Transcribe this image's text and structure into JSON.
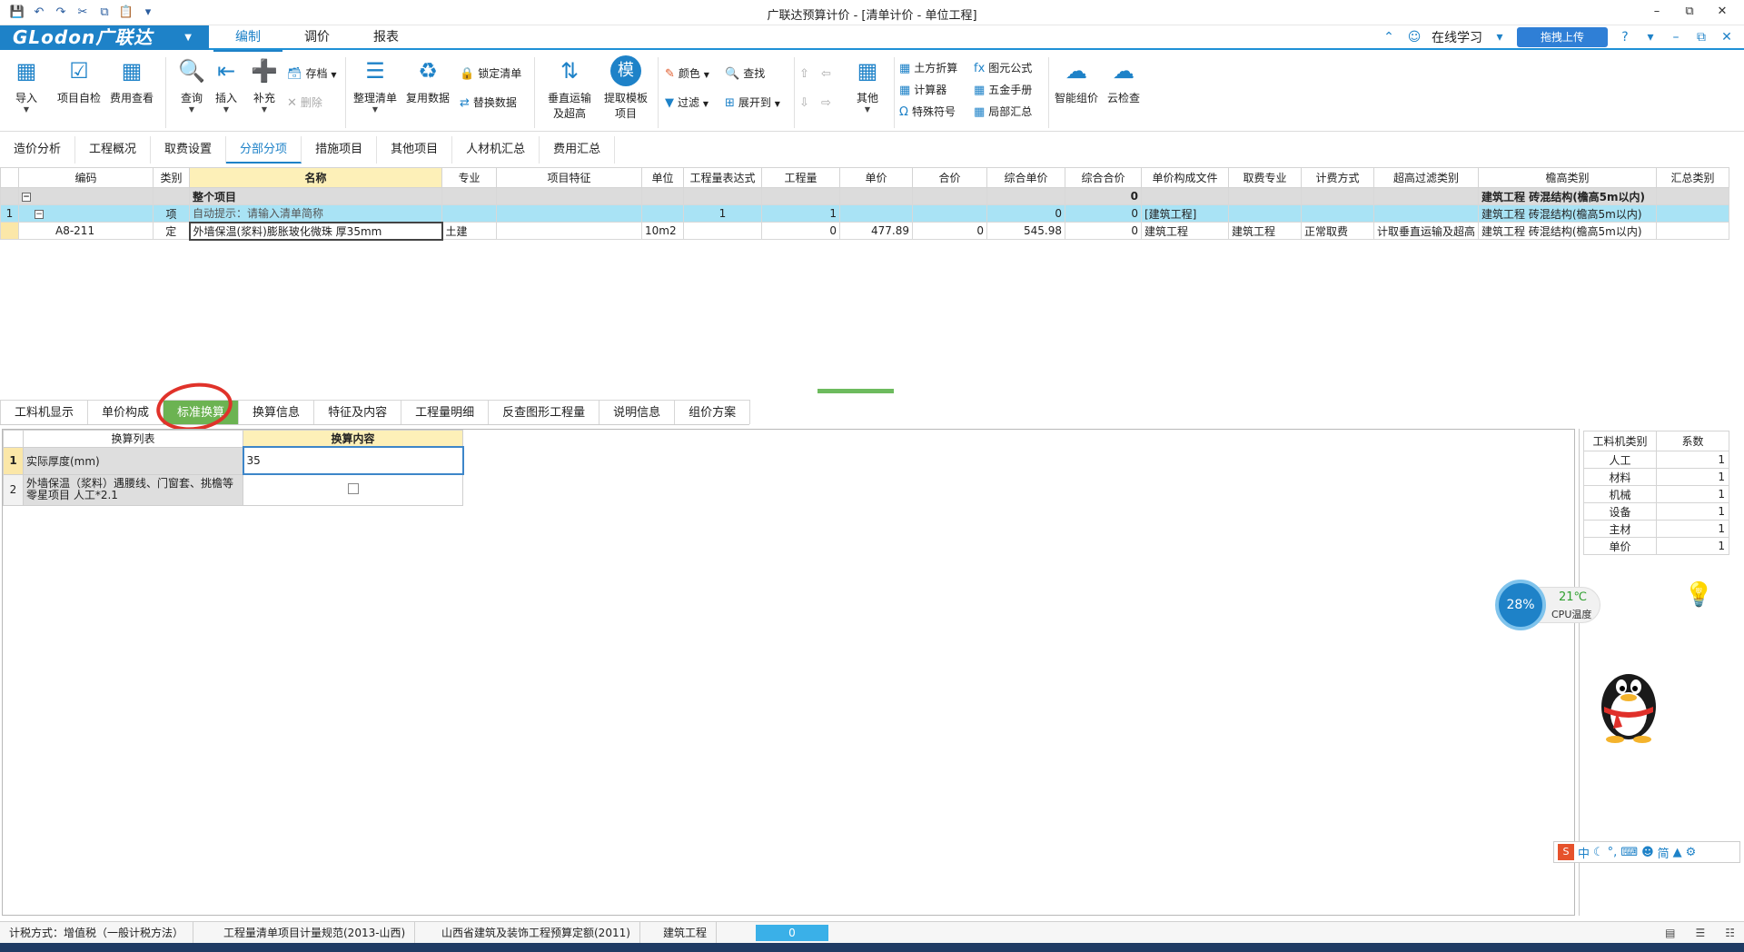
{
  "window": {
    "title": "广联达预算计价 - [清单计价 - 单位工程]",
    "quick_access": [
      "save-icon",
      "undo-icon",
      "redo-icon",
      "cut-icon",
      "copy-icon",
      "paste-icon",
      "more-icon"
    ]
  },
  "menubar": {
    "logo": "GLodon广联达",
    "items": [
      "编制",
      "调价",
      "报表"
    ],
    "active": "编制",
    "online_study": "在线学习",
    "upload": "拖拽上传"
  },
  "ribbon": {
    "import": "导入",
    "self_check": "项目自检",
    "fee_view": "费用查看",
    "query": "查询",
    "insert": "插入",
    "supplement": "补充",
    "archive": "存档",
    "delete": "删除",
    "organize": "整理清单",
    "reuse": "复用数据",
    "lock": "锁定清单",
    "replace": "替换数据",
    "vertical_transport": "垂直运输\n及超高",
    "extract_template": "提取模板\n项目",
    "color": "颜色",
    "find": "查找",
    "filter": "过滤",
    "expand_to": "展开到",
    "other": "其他",
    "earthwork": "土方折算",
    "calculator": "计算器",
    "special_symbol": "特殊符号",
    "element_formula": "图元公式",
    "hardware_manual": "五金手册",
    "local_summary": "局部汇总",
    "smart_pricing": "智能组价",
    "cloud_check": "云检查"
  },
  "main_tabs": [
    "造价分析",
    "工程概况",
    "取费设置",
    "分部分项",
    "措施项目",
    "其他项目",
    "人材机汇总",
    "费用汇总"
  ],
  "main_tab_active": "分部分项",
  "grid": {
    "headers": [
      "编码",
      "类别",
      "名称",
      "专业",
      "项目特征",
      "单位",
      "工程量表达式",
      "工程量",
      "单价",
      "合价",
      "综合单价",
      "综合合价",
      "单价构成文件",
      "取费专业",
      "计费方式",
      "超高过滤类别",
      "檐高类别",
      "汇总类别"
    ],
    "group_row": {
      "name": "整个项目",
      "total": "0",
      "eaves": "建筑工程  砖混结构(檐高5m以内)"
    },
    "item_row": {
      "no": "1",
      "type": "项",
      "name": "自动提示：请输入清单简称",
      "qty_expr": "1",
      "qty": "1",
      "comp_total": "0",
      "comp_sum": "0",
      "unit_file": "[建筑工程]",
      "eaves": "建筑工程  砖混结构(檐高5m以内)"
    },
    "sub_row": {
      "code": "A8-211",
      "type": "定",
      "name": "外墙保温(浆料)膨胀玻化微珠 厚35mm",
      "spec": "土建",
      "unit": "10m2",
      "qty": "0",
      "price": "477.89",
      "total": "0",
      "comp_price": "545.98",
      "comp_total": "0",
      "unit_file": "建筑工程",
      "fee_spec": "建筑工程",
      "calc": "正常取费",
      "over": "计取垂直运输及超高",
      "eaves": "建筑工程  砖混结构(檐高5m以内)"
    }
  },
  "sub_tabs": [
    "工料机显示",
    "单价构成",
    "标准换算",
    "换算信息",
    "特征及内容",
    "工程量明细",
    "反查图形工程量",
    "说明信息",
    "组价方案"
  ],
  "sub_tab_active": "标准换算",
  "conversion": {
    "headers": [
      "换算列表",
      "换算内容"
    ],
    "rows": [
      {
        "no": "1",
        "label": "实际厚度(mm)",
        "value": "35"
      },
      {
        "no": "2",
        "label": "外墙保温（浆料）遇腰线、门窗套、挑檐等零星项目 人工*2.1",
        "value": ""
      }
    ]
  },
  "factors": {
    "headers": [
      "工料机类别",
      "系数"
    ],
    "rows": [
      {
        "category": "人工",
        "value": "1"
      },
      {
        "category": "材料",
        "value": "1"
      },
      {
        "category": "机械",
        "value": "1"
      },
      {
        "category": "设备",
        "value": "1"
      },
      {
        "category": "主材",
        "value": "1"
      },
      {
        "category": "单价",
        "value": "1"
      }
    ]
  },
  "cpu_widget": {
    "percent": "28%",
    "temp": "21℃",
    "label": "CPU温度"
  },
  "ime": {
    "mode": "中",
    "simp": "简"
  },
  "status": {
    "tax": "计税方式：增值税（一般计税方法）",
    "rule": "工程量清单项目计量规范(2013-山西)",
    "quota": "山西省建筑及装饰工程预算定额(2011)",
    "project": "建筑工程",
    "progress": "0"
  },
  "colors": {
    "accent": "#1e82c8",
    "active_subtab": "#6cb352",
    "item_row": "#a9e3f5",
    "header_highlight": "#fdf0b8",
    "annotation": "#e0322a"
  }
}
